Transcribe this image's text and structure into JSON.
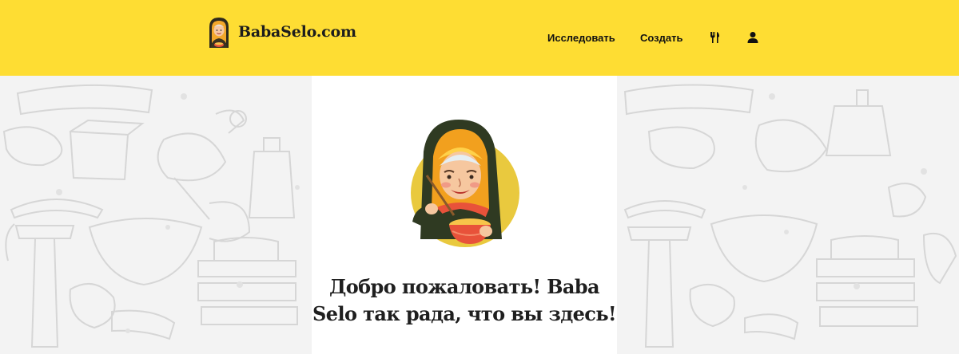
{
  "header": {
    "brand": "BabaSelo.com",
    "nav": {
      "explore_label": "Исследовать",
      "create_label": "Создать",
      "recipes_icon": "fork-knife-icon",
      "profile_icon": "user-icon"
    },
    "background_color": "#fedd33"
  },
  "main": {
    "welcome_text": "Добро пожаловать! Baba Selo так рада, что вы здесь!",
    "avatar": "grandma-cooking-avatar"
  },
  "colors": {
    "accent": "#fedd33",
    "avatar_circle": "#e9c93e",
    "text": "#1f1f1f"
  }
}
